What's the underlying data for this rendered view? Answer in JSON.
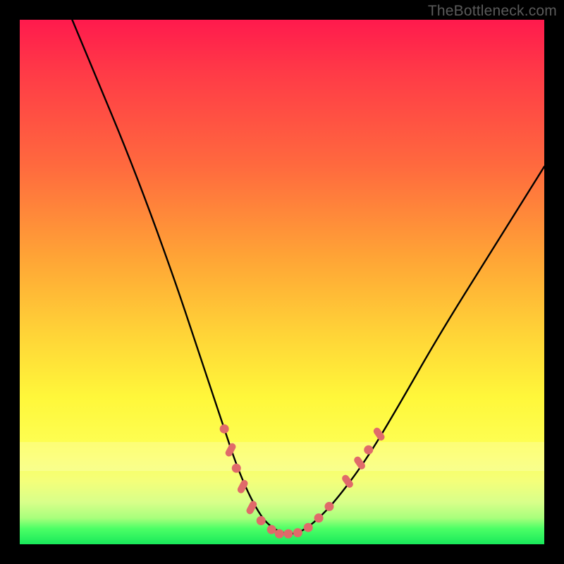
{
  "watermark": "TheBottleneck.com",
  "chart_data": {
    "type": "line",
    "title": "",
    "xlabel": "",
    "ylabel": "",
    "xlim": [
      0,
      100
    ],
    "ylim": [
      0,
      100
    ],
    "series": [
      {
        "name": "bottleneck-curve",
        "x": [
          10,
          15,
          20,
          25,
          30,
          33,
          36,
          39,
          41,
          43,
          45,
          47,
          50,
          53,
          56,
          60,
          66,
          72,
          80,
          90,
          100
        ],
        "y": [
          100,
          88,
          76,
          63,
          49,
          40,
          31,
          22,
          16,
          11,
          7,
          4,
          2,
          2,
          4,
          8,
          16,
          26,
          40,
          56,
          72
        ]
      }
    ],
    "markers": {
      "name": "highlight-dots",
      "color": "#e06a6a",
      "points": [
        {
          "x": 39.0,
          "y": 22.0,
          "shape": "dot"
        },
        {
          "x": 40.2,
          "y": 18.0,
          "shape": "pill-diag"
        },
        {
          "x": 41.3,
          "y": 14.5,
          "shape": "dot"
        },
        {
          "x": 42.5,
          "y": 11.0,
          "shape": "pill-diag"
        },
        {
          "x": 44.2,
          "y": 7.0,
          "shape": "pill-diag"
        },
        {
          "x": 46.0,
          "y": 4.5,
          "shape": "dot"
        },
        {
          "x": 48.0,
          "y": 2.8,
          "shape": "dot"
        },
        {
          "x": 49.5,
          "y": 2.0,
          "shape": "dot"
        },
        {
          "x": 51.2,
          "y": 2.0,
          "shape": "dot"
        },
        {
          "x": 53.0,
          "y": 2.2,
          "shape": "dot"
        },
        {
          "x": 55.0,
          "y": 3.2,
          "shape": "dot"
        },
        {
          "x": 57.0,
          "y": 5.0,
          "shape": "dot"
        },
        {
          "x": 59.0,
          "y": 7.2,
          "shape": "dot"
        },
        {
          "x": 62.5,
          "y": 12.0,
          "shape": "pill-diag-r"
        },
        {
          "x": 64.8,
          "y": 15.5,
          "shape": "pill-diag-r"
        },
        {
          "x": 66.5,
          "y": 18.0,
          "shape": "dot"
        },
        {
          "x": 68.5,
          "y": 21.0,
          "shape": "pill-diag-r"
        }
      ]
    }
  }
}
